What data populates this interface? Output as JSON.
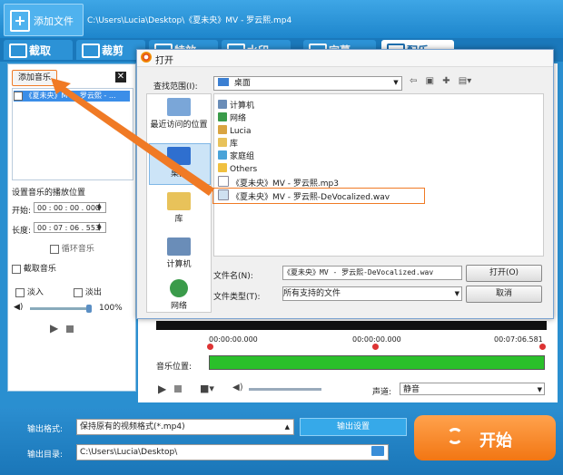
{
  "app": {
    "add_file_label": "添加文件",
    "file_path": "C:\\Users\\Lucia\\Desktop\\《夏未央》MV - 罗云熙.mp4"
  },
  "tabs": [
    {
      "label": "截取"
    },
    {
      "label": "裁剪"
    },
    {
      "label": "特效"
    },
    {
      "label": "水印"
    },
    {
      "label": "字幕"
    },
    {
      "label": "配乐"
    }
  ],
  "left_panel": {
    "add_music_label": "添加音乐",
    "close_label": "✕",
    "music_item": "《夏未央》MV - 罗云熙 - ...",
    "position_heading": "设置音乐的播放位置",
    "start_label": "开始:",
    "start_value": "00 : 00 : 00 . 000",
    "length_label": "长度:",
    "length_value": "00 : 07 : 06 . 553",
    "loop_label": "循环音乐",
    "extract_label": "截取音乐",
    "fade_in_label": "淡入",
    "fade_out_label": "淡出",
    "volume_percent": "100%"
  },
  "preview": {
    "time_start": "00:00:00.000",
    "time_mid": "00:00:00.000",
    "time_end": "00:07:06.581",
    "position_label": "音乐位置:",
    "voice_label": "声道:",
    "voice_value": "静音"
  },
  "dialog": {
    "title": "打开",
    "look_in_label": "查找范围(I):",
    "look_in_value": "桌面",
    "places": [
      {
        "label": "最近访问的位置"
      },
      {
        "label": "桌面"
      },
      {
        "label": "库"
      },
      {
        "label": "计算机"
      },
      {
        "label": "网络"
      }
    ],
    "files": [
      {
        "name": "计算机",
        "icon": "computer-icon"
      },
      {
        "name": "网络",
        "icon": "network-icon"
      },
      {
        "name": "Lucia",
        "icon": "user-folder-icon"
      },
      {
        "name": "库",
        "icon": "library-icon"
      },
      {
        "name": "家庭组",
        "icon": "homegroup-icon"
      },
      {
        "name": "Others",
        "icon": "folder-icon"
      },
      {
        "name": "《夏未央》MV - 罗云熙.mp3",
        "icon": "audio-file-icon"
      },
      {
        "name": "《夏未央》MV - 罗云熙-DeVocalized.wav",
        "icon": "audio-file-icon"
      }
    ],
    "file_name_label": "文件名(N):",
    "file_name_value": "《夏未央》MV - 罗云熙-DeVocalized.wav",
    "file_type_label": "文件类型(T):",
    "file_type_value": "所有支持的文件",
    "open_label": "打开(O)",
    "cancel_label": "取消"
  },
  "bottom": {
    "format_label": "输出格式:",
    "format_value": "保持原有的视频格式(*.mp4)",
    "output_settings_label": "输出设置",
    "dir_label": "输出目录:",
    "dir_value": "C:\\Users\\Lucia\\Desktop\\",
    "start_label": "开始"
  },
  "colors": {
    "accent": "#1e86cc",
    "highlight": "#f07a25",
    "progress": "#2ac02a",
    "start_button": "#f27613"
  }
}
